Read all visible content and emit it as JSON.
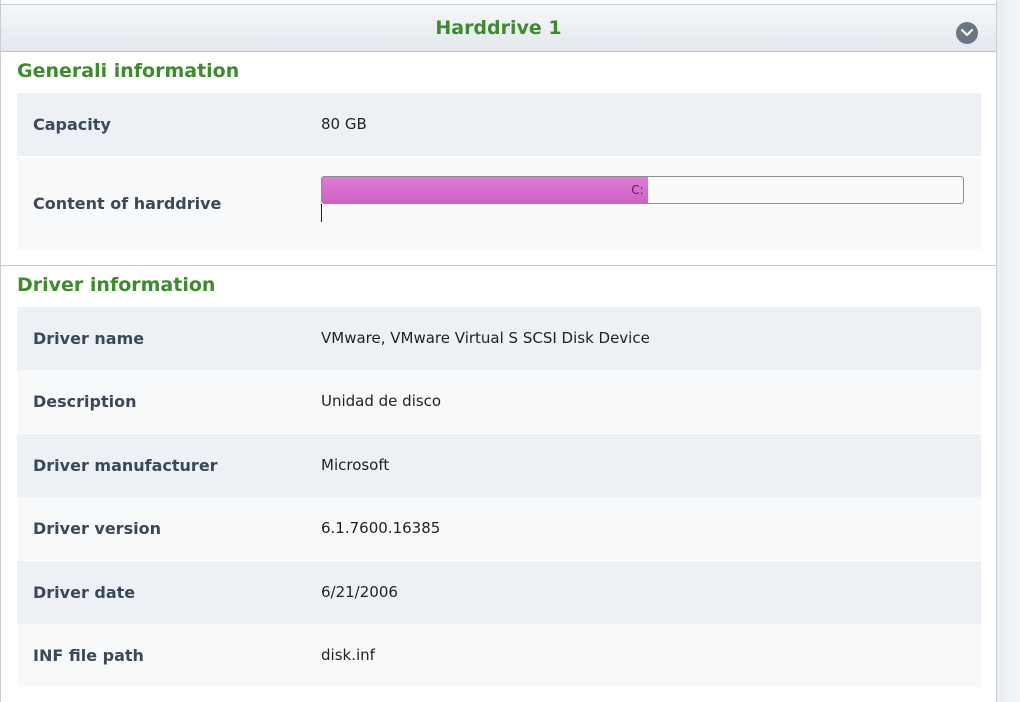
{
  "header": {
    "title": "Harddrive 1",
    "collapse_icon": "chevron-down-icon"
  },
  "general": {
    "title": "Generali information",
    "capacity": {
      "label": "Capacity",
      "value": "80 GB"
    },
    "content": {
      "label": "Content of harddrive",
      "partitions": [
        {
          "name": "C:",
          "fraction_used": 0.508,
          "color": "#d66fcf"
        }
      ]
    }
  },
  "driver": {
    "title": "Driver information",
    "rows": [
      {
        "label": "Driver name",
        "value": "VMware, VMware Virtual S SCSI Disk Device"
      },
      {
        "label": "Description",
        "value": "Unidad de disco"
      },
      {
        "label": "Driver manufacturer",
        "value": "Microsoft"
      },
      {
        "label": "Driver version",
        "value": "6.1.7600.16385"
      },
      {
        "label": "Driver date",
        "value": "6/21/2006"
      },
      {
        "label": "INF file path",
        "value": "disk.inf"
      }
    ]
  },
  "colors": {
    "accent_green": "#3f8a2f",
    "row_shade": "#edf1f6",
    "label_text": "#3a4858"
  }
}
